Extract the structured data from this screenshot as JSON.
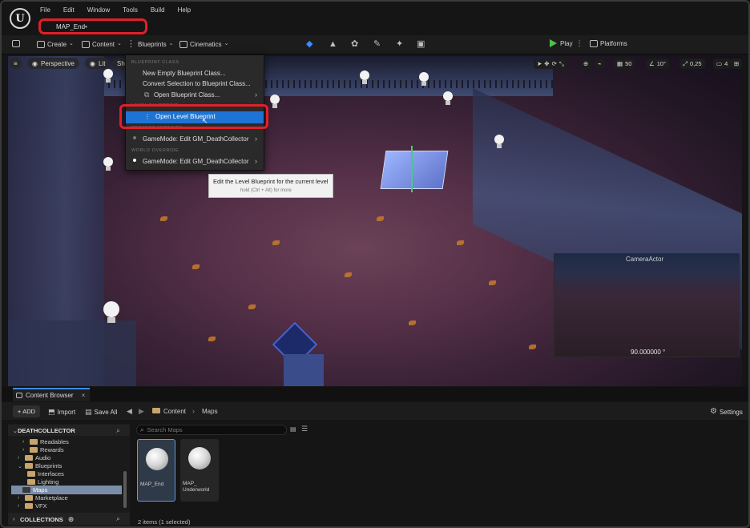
{
  "menu": [
    "File",
    "Edit",
    "Window",
    "Tools",
    "Build",
    "Help"
  ],
  "map_tab": "MAP_End•",
  "toolbar": {
    "create": "Create",
    "content": "Content",
    "blueprints": "Blueprints",
    "cinematics": "Cinematics",
    "play": "Play",
    "platforms": "Platforms"
  },
  "viewport": {
    "perspective": "Perspective",
    "lit": "Lit",
    "show_partial": "Sh",
    "grid_snap": "50",
    "angle_snap": "10°",
    "scale_snap": "0,25",
    "camera_speed": "4",
    "camera_preview_title": "CameraActor",
    "camera_preview_value": "90.000000 °"
  },
  "dropdown": {
    "section_blueprint_class": "BLUEPRINT CLASS",
    "new_empty": "New Empty Blueprint Class...",
    "convert": "Convert Selection to Blueprint Class...",
    "open_class": "Open Blueprint Class...",
    "section_level": "LEVEL BLUEPRINT",
    "open_level": "Open Level Blueprint",
    "section_project": "PROJECT SETTINGS",
    "gamemode_project": "GameMode: Edit GM_DeathCollector",
    "section_world": "WORLD OVERRIDE",
    "gamemode_world": "GameMode: Edit GM_DeathCollector"
  },
  "tooltip": {
    "main": "Edit the Level Blueprint for the current level",
    "sub": "hold (Ctrl + Alt) for more"
  },
  "content_browser": {
    "tab": "Content Browser",
    "add": "ADD",
    "import": "Import",
    "save_all": "Save All",
    "path": [
      "Content",
      "Maps"
    ],
    "settings": "Settings",
    "root": "DEATHCOLLECTOR",
    "search_placeholder": "Search Maps",
    "tree": [
      {
        "label": "Readables",
        "level": 1,
        "arrow": true
      },
      {
        "label": "Rewards",
        "level": 1,
        "arrow": true
      },
      {
        "label": "Audio",
        "level": 0,
        "arrow": true
      },
      {
        "label": "Blueprints",
        "level": 0,
        "arrow": true,
        "open": true
      },
      {
        "label": "Interfaces",
        "level": 1,
        "arrow": false
      },
      {
        "label": "Lighting",
        "level": 1,
        "arrow": false
      },
      {
        "label": "Maps",
        "level": 0,
        "arrow": false,
        "selected": true
      },
      {
        "label": "Marketplace",
        "level": 0,
        "arrow": true
      },
      {
        "label": "VFX",
        "level": 0,
        "arrow": true
      }
    ],
    "collections": "COLLECTIONS",
    "assets": [
      {
        "name": "MAP_End",
        "selected": true
      },
      {
        "name": "MAP_\nUnderworld",
        "selected": false
      }
    ],
    "status": "2 items (1 selected)"
  },
  "colors": {
    "highlight_red": "#e0202a",
    "selection_blue": "#1e74d4",
    "accent_blue": "#3b8cff",
    "play_green": "#4fc24a"
  }
}
